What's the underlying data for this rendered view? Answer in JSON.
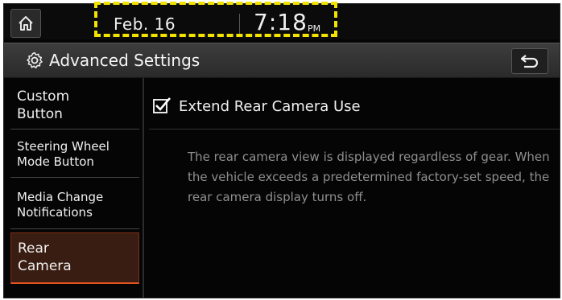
{
  "status_bar": {
    "date": "Feb. 16",
    "time": "7:18",
    "ampm": "PM"
  },
  "header": {
    "title": "Advanced Settings"
  },
  "sidebar": {
    "items": [
      {
        "label": "Custom\nButton",
        "active": false
      },
      {
        "label": "Steering Wheel\nMode Button",
        "active": false
      },
      {
        "label": "Media Change\nNotifications",
        "active": false
      },
      {
        "label": "Rear\nCamera",
        "active": true
      }
    ]
  },
  "main": {
    "option_label": "Extend Rear Camera Use",
    "option_checked": true,
    "description": "The rear camera view is displayed regardless of gear. When the vehicle exceeds a predetermined factory-set speed, the rear camera display turns off."
  },
  "colors": {
    "highlight": "#f2e400",
    "active_accent": "#e0531f",
    "background": "#050505"
  },
  "icons": [
    "home-icon",
    "gear-icon",
    "back-arrow-icon",
    "checkmark-icon"
  ]
}
